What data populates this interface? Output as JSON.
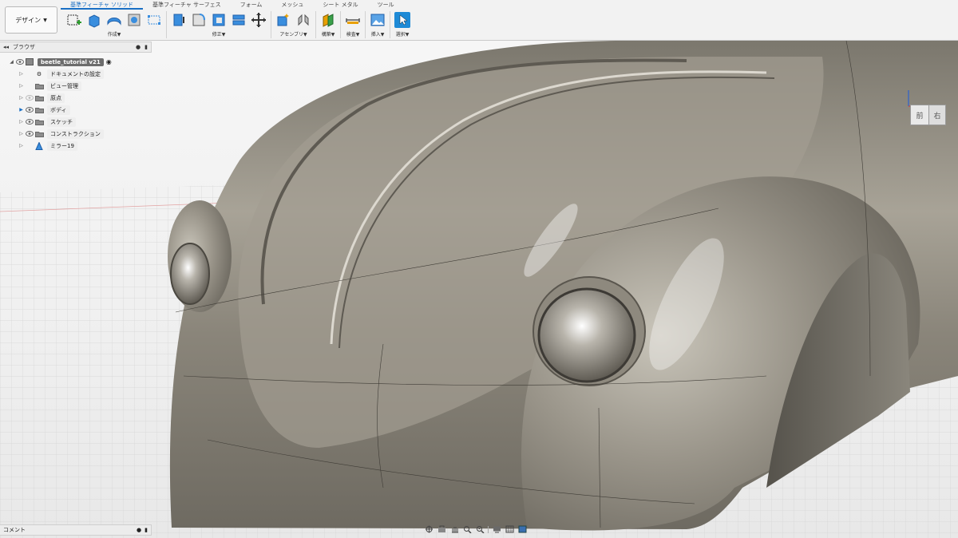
{
  "workspace": {
    "label": "デザイン"
  },
  "tabs": [
    {
      "label": "基準フィーチャ ソリッド",
      "active": true
    },
    {
      "label": "基準フィーチャ サーフェス",
      "active": false
    },
    {
      "label": "フォーム",
      "active": false
    },
    {
      "label": "メッシュ",
      "active": false
    },
    {
      "label": "シート メタル",
      "active": false
    },
    {
      "label": "ツール",
      "active": false
    }
  ],
  "groups": {
    "create": "作成▼",
    "modify": "修正▼",
    "assemble": "アセンブリ▼",
    "construct": "構築▼",
    "inspect": "検査▼",
    "insert": "挿入▼",
    "select": "選択▼"
  },
  "browser": {
    "title": "ブラウザ",
    "items": [
      {
        "label": "beetle_tutorial v21",
        "icon": "component-icon"
      },
      {
        "label": "ドキュメントの設定",
        "icon": "gear-icon"
      },
      {
        "label": "ビュー管理",
        "icon": "folder-icon"
      },
      {
        "label": "原点",
        "icon": "folder-icon"
      },
      {
        "label": "ボディ",
        "icon": "folder-icon"
      },
      {
        "label": "スケッチ",
        "icon": "folder-icon"
      },
      {
        "label": "コンストラクション",
        "icon": "folder-icon"
      },
      {
        "label": "ミラー19",
        "icon": "mirror-icon"
      }
    ]
  },
  "comments": {
    "title": "コメント"
  },
  "viewcube": {
    "front": "前",
    "right": "右"
  },
  "colors": {
    "accent": "#1a6fc4",
    "select_active": "#1e8ad6",
    "model": "#8f8a7e",
    "grid": "#d6d6d6"
  }
}
